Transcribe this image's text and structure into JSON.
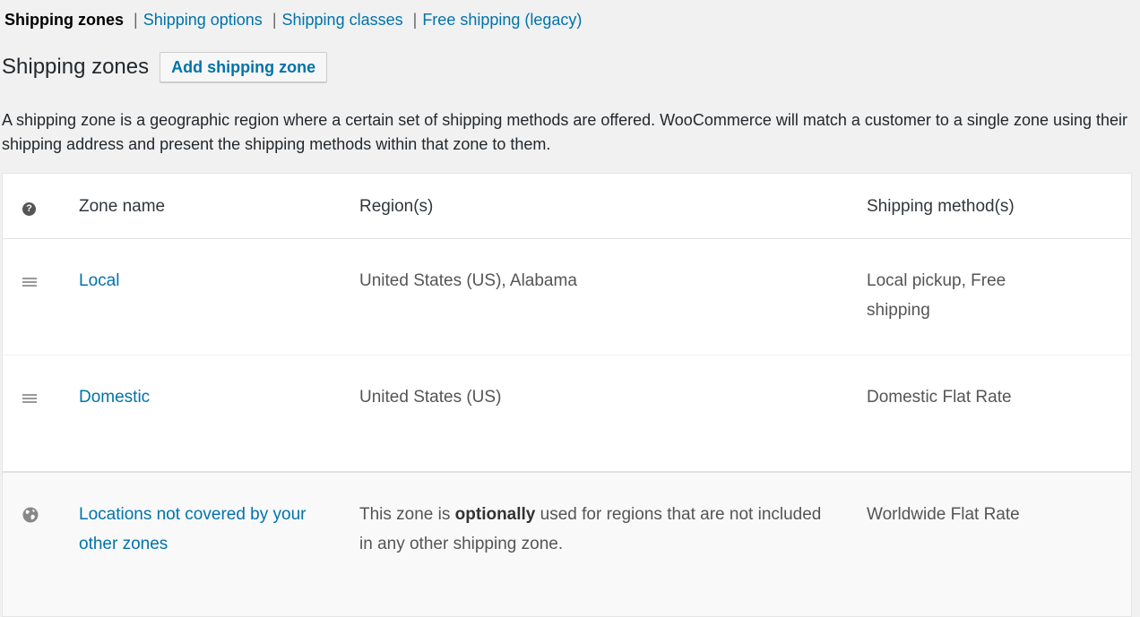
{
  "subnav": {
    "current": "Shipping zones",
    "links": [
      "Shipping options",
      "Shipping classes",
      "Free shipping (legacy)"
    ],
    "separator": "|"
  },
  "page": {
    "title": "Shipping zones",
    "add_button": "Add shipping zone",
    "description": "A shipping zone is a geographic region where a certain set of shipping methods are offered. WooCommerce will match a customer to a single zone using their shipping address and present the shipping methods within that zone to them."
  },
  "table": {
    "header_icon": "help-icon",
    "columns": [
      "Zone name",
      "Region(s)",
      "Shipping method(s)"
    ],
    "zones": [
      {
        "icon": "drag-handle-icon",
        "name": "Local",
        "region": "United States (US), Alabama",
        "methods": "Local pickup, Free shipping"
      },
      {
        "icon": "drag-handle-icon",
        "name": "Domestic",
        "region": "United States (US)",
        "methods": "Domestic Flat Rate"
      }
    ],
    "default_zone": {
      "icon": "globe-icon",
      "name": "Locations not covered by your other zones",
      "region_pre": "This zone is ",
      "region_bold": "optionally",
      "region_post": " used for regions that are not included in any other shipping zone.",
      "methods": "Worldwide Flat Rate"
    }
  }
}
